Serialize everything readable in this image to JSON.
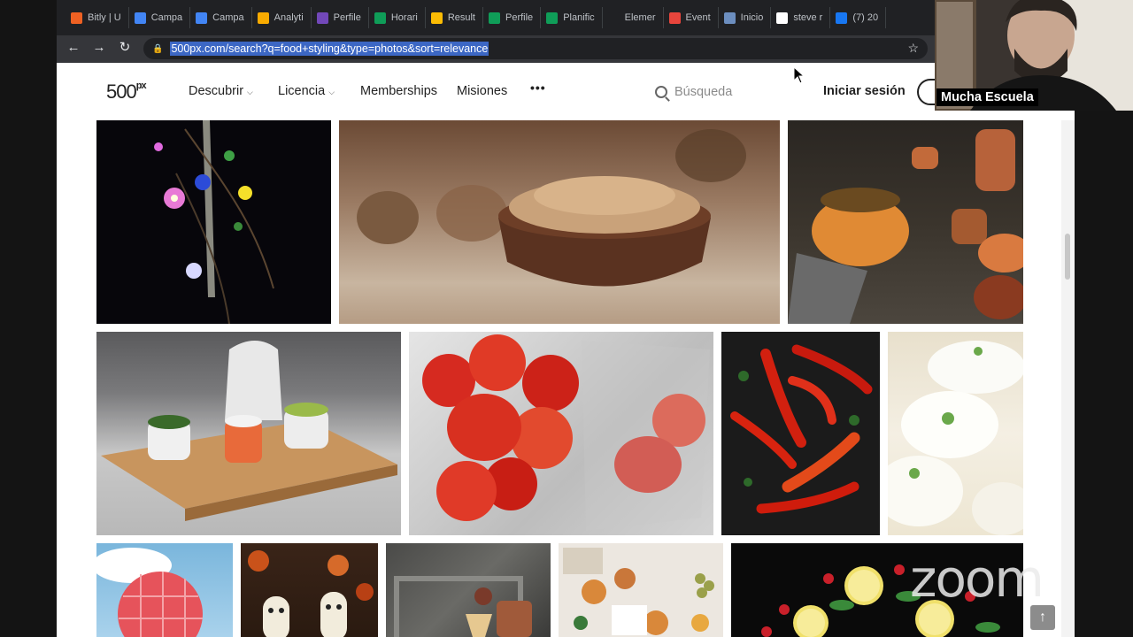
{
  "browser": {
    "tabs": [
      {
        "label": "Bitly | U",
        "icon": "bitly-icon",
        "color": "#ee6123"
      },
      {
        "label": "Campa",
        "icon": "google-ads-icon",
        "color": "#4285f4"
      },
      {
        "label": "Campa",
        "icon": "google-ads-icon",
        "color": "#4285f4"
      },
      {
        "label": "Analyti",
        "icon": "analytics-icon",
        "color": "#f9ab00"
      },
      {
        "label": "Perfile",
        "icon": "forms-icon",
        "color": "#7248b9"
      },
      {
        "label": "Horari",
        "icon": "sheets-icon",
        "color": "#0f9d58"
      },
      {
        "label": "Result",
        "icon": "drive-icon",
        "color": "#fbbc04"
      },
      {
        "label": "Perfile",
        "icon": "sheets-icon",
        "color": "#0f9d58"
      },
      {
        "label": "Planific",
        "icon": "sheets-icon",
        "color": "#0f9d58"
      },
      {
        "label": "Elemer",
        "icon": "blank-icon",
        "color": "#202124"
      },
      {
        "label": "Event",
        "icon": "calendar-icon",
        "color": "#e8453c"
      },
      {
        "label": "Inicio",
        "icon": "shield-icon",
        "color": "#6c8ebf"
      },
      {
        "label": "steve r",
        "icon": "google-icon",
        "color": "#ffffff"
      },
      {
        "label": "(7) 20",
        "icon": "facebook-icon",
        "color": "#1877f2"
      }
    ],
    "url": "500px.com/search?q=food+styling&type=photos&sort=relevance"
  },
  "site": {
    "logo_main": "500",
    "logo_sup": "px",
    "nav": {
      "discover": "Descubrir",
      "license": "Licencia",
      "memberships": "Memberships",
      "quests": "Misiones",
      "more": "•••"
    },
    "search_placeholder": "Búsqueda",
    "login": "Iniciar sesión"
  },
  "photos": [
    {
      "name": "photo-flowers-fork",
      "subject": "flowers and fork on black"
    },
    {
      "name": "photo-walnuts-bowl",
      "subject": "walnuts in wooden bowl"
    },
    {
      "name": "photo-pumpkin-stew",
      "subject": "pumpkin stew rustic table"
    },
    {
      "name": "photo-sushi-board",
      "subject": "sushi rolls on wooden board"
    },
    {
      "name": "photo-tomatoes",
      "subject": "cherry tomatoes on cloth"
    },
    {
      "name": "photo-red-chili",
      "subject": "red chili peppers on slate"
    },
    {
      "name": "photo-meringue",
      "subject": "cream meringue with mint"
    },
    {
      "name": "photo-red-ball",
      "subject": "red ball with cloud"
    },
    {
      "name": "photo-banana-ghosts",
      "subject": "banana ghosts"
    },
    {
      "name": "photo-drink-frame",
      "subject": "drink with passion fruit"
    },
    {
      "name": "photo-cupcakes",
      "subject": "muffins and grapes"
    },
    {
      "name": "photo-citrus-dark",
      "subject": "lemon slices and raspberries"
    }
  ],
  "overlay": {
    "participant_name": "Mucha Escuela",
    "watermark": "zoom",
    "to_top": "↑"
  }
}
